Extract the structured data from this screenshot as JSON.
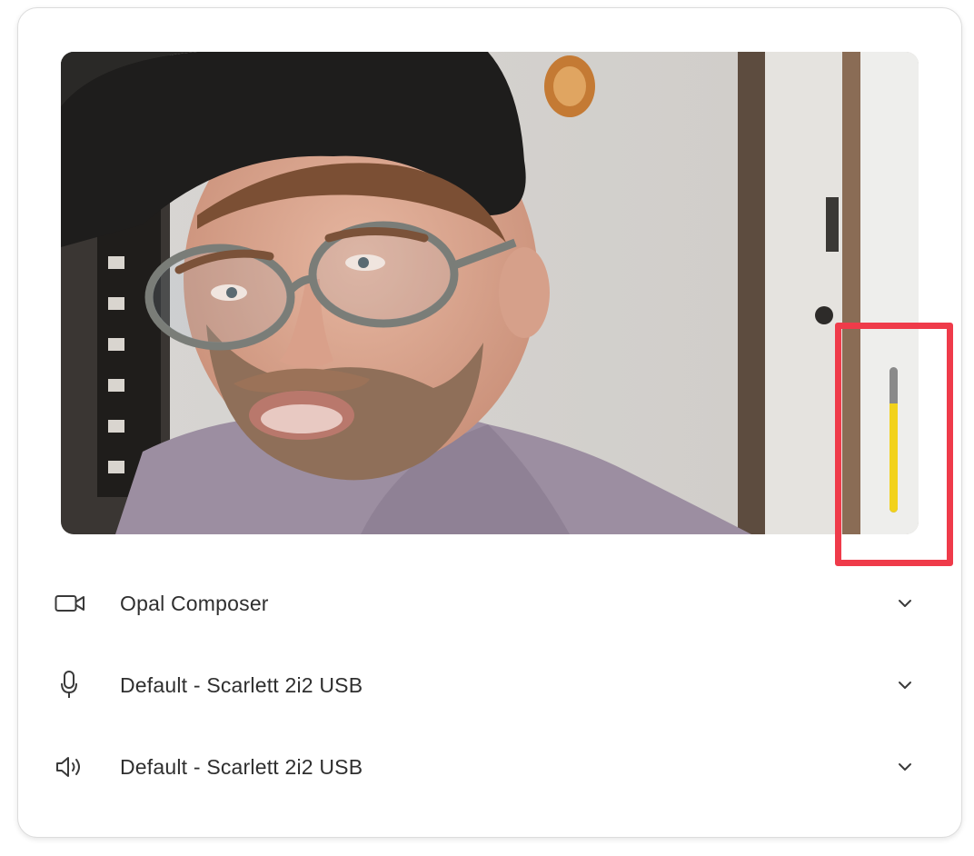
{
  "colors": {
    "highlight": "#ef3b4a",
    "meter_fill": "#f2d21b",
    "meter_track": "#8a8a8a",
    "text": "#2f2f2f"
  },
  "preview": {
    "content": "camera-preview"
  },
  "audio_meter": {
    "level": 0.75
  },
  "devices": {
    "camera": {
      "icon": "video-camera-icon",
      "label": "Opal Composer"
    },
    "microphone": {
      "icon": "microphone-icon",
      "label": "Default - Scarlett 2i2 USB"
    },
    "speaker": {
      "icon": "speaker-icon",
      "label": "Default - Scarlett 2i2 USB"
    }
  }
}
